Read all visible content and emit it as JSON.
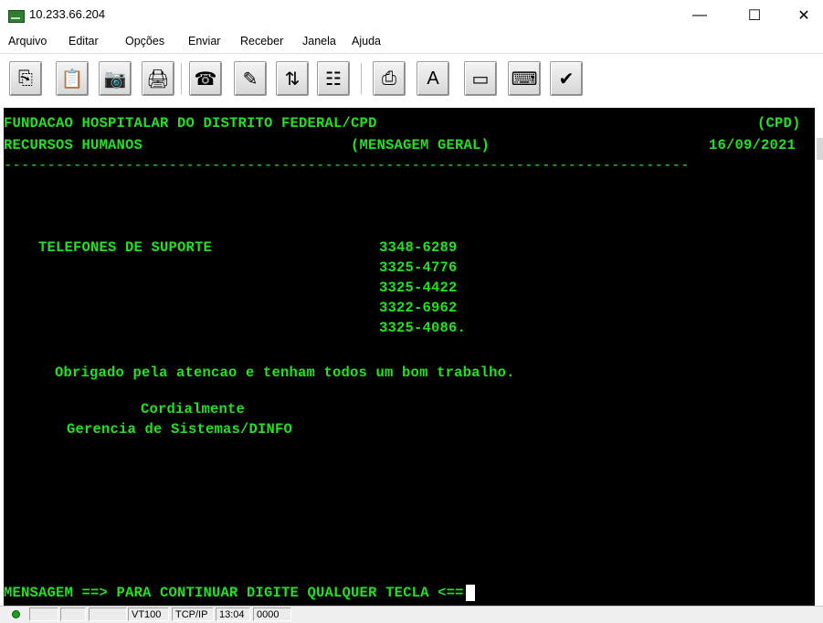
{
  "window": {
    "title": "10.233.66.204",
    "minimize": "—",
    "maximize": "☐",
    "close": "✕"
  },
  "menu": [
    "Arquivo",
    "Editar",
    "Opções",
    "Enviar",
    "Receber",
    "Janela",
    "Ajuda"
  ],
  "toolbar": {
    "icons": [
      "copy-icon",
      "paste-icon",
      "camera-icon",
      "print-icon",
      "phone-icon",
      "pen-icon",
      "transfer-icon",
      "network-icon",
      "print-screen-icon",
      "spellcheck-icon",
      "terminal-icon",
      "keyboard-icon",
      "edit-image-icon"
    ],
    "glyphs": [
      "⎘",
      "📋",
      "📷",
      "🖨",
      "☎",
      "✎",
      "⇅",
      "☷",
      "⎙",
      "A",
      "▭",
      "⌨",
      "✔"
    ]
  },
  "terminal": {
    "header_left_1": "FUNDACAO HOSPITALAR DO DISTRITO FEDERAL/CPD",
    "header_right_1": "(CPD)",
    "header_left_2": "RECURSOS HUMANOS",
    "header_center_2": "(MENSAGEM GERAL)",
    "header_right_2": "16/09/2021",
    "divider": "-------------------------------------------------------------------------------",
    "support_label": "TELEFONES DE SUPORTE",
    "phones": [
      "3348-6289",
      "3325-4776",
      "3325-4422",
      "3322-6962",
      "3325-4086."
    ],
    "thanks": "Obrigado pela atencao e tenham todos um bom trabalho.",
    "closing": "Cordialmente",
    "signature": "Gerencia de Sistemas/DINFO",
    "prompt": "MENSAGEM ==> PARA CONTINUAR DIGITE QUALQUER TECLA <=="
  },
  "status": {
    "emulation": "VT100",
    "protocol": "TCP/IP",
    "time": "13:04",
    "indicator": "0000"
  },
  "colors": {
    "terminal_bg": "#000000",
    "terminal_fg": "#22e022",
    "status_led": "#1aa01a"
  }
}
